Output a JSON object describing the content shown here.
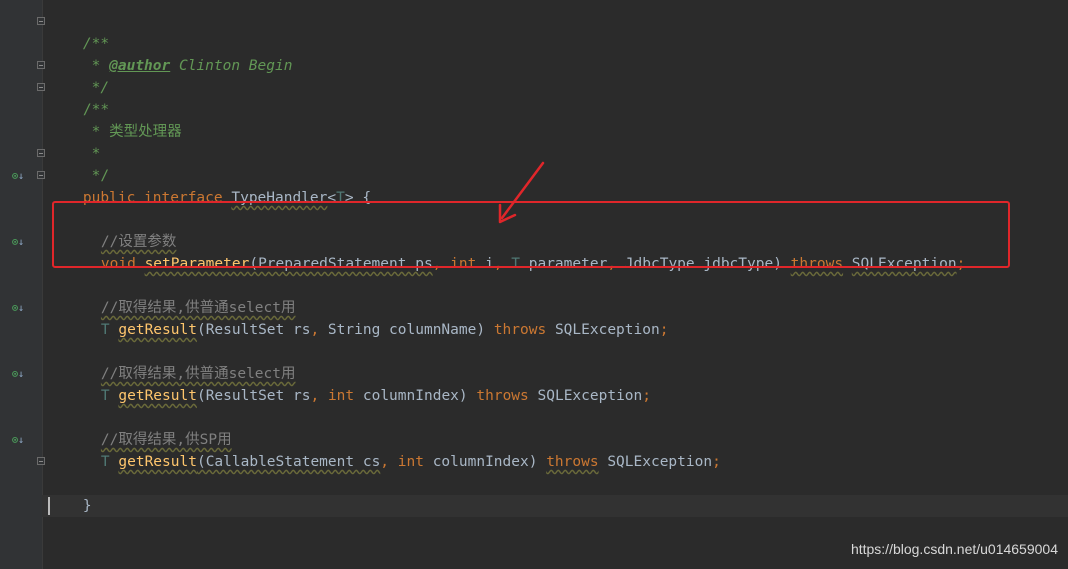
{
  "code": {
    "l1_open": "/**",
    "l2_star": " * ",
    "l2_tag": "@author",
    "l2_text": " Clinton Begin",
    "l3": " */",
    "l4": "/**",
    "l5": " * 类型处理器",
    "l6": " *",
    "l7": " */",
    "l8_public": "public",
    "l8_interface": "interface",
    "l8_name": "TypeHandler",
    "l8_lt": "<",
    "l8_T": "T",
    "l8_rest": "> {",
    "c1": "//设置参数",
    "m1_void": "void",
    "m1_name": "setParameter",
    "m1_p1": "(PreparedStatement ps",
    "m1_int": "int",
    "m1_i": " i",
    "m1_T": "T",
    "m1_param": " parameter",
    "m1_jdbc": " JdbcType jdbcType)",
    "m1_throws": "throws",
    "m1_exc": "SQLException",
    "c2": "//取得结果,供普通select用",
    "m2_T": "T",
    "m2_name": "getResult",
    "m2_p1": "(ResultSet rs",
    "m2_p2": " String columnName)",
    "m2_throws": "throws",
    "m2_exc": "SQLException",
    "c3": "//取得结果,供普通select用",
    "m3_T": "T",
    "m3_name": "getResult",
    "m3_p1": "(ResultSet rs",
    "m3_int": "int",
    "m3_p2": " columnIndex)",
    "m3_throws": "throws",
    "m3_exc": "SQLException",
    "c4": "//取得结果,供SP用",
    "m4_T": "T",
    "m4_name": "getResult",
    "m4_p1": "(CallableStatement cs",
    "m4_int": "int",
    "m4_p2": " columnIndex)",
    "m4_throws": "throws",
    "m4_exc": "SQLException",
    "close": "}"
  },
  "punct": {
    "comma": ",",
    "semi": ";",
    "sp": " "
  },
  "gutter": {
    "icon_glyph": "⊙",
    "arrow_glyph": "↓"
  },
  "watermark": "https://blog.csdn.net/u014659004",
  "colors": {
    "background": "#2b2b2b",
    "keyword": "#cc7832",
    "doc_comment": "#629755",
    "line_comment": "#808080",
    "method": "#ffc66d",
    "type_param": "#507874",
    "highlight_box": "#e0262a"
  }
}
